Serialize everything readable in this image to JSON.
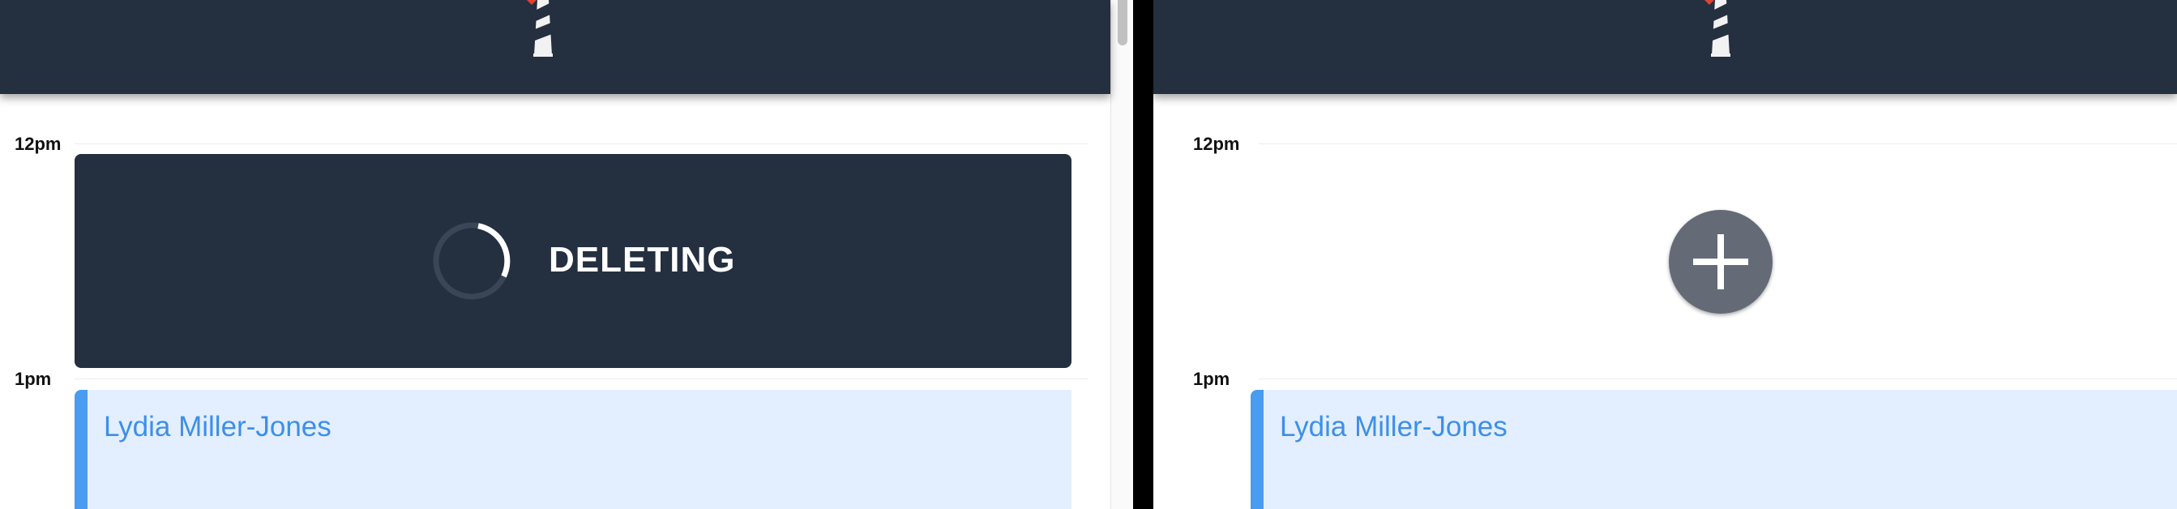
{
  "left_panel": {
    "time_labels": [
      "12pm",
      "1pm"
    ],
    "deleting_card": {
      "status_text": "DELETING",
      "spinner_icon": "loading-spinner-icon"
    },
    "appointment": {
      "client_name": "Lydia Miller-Jones"
    }
  },
  "right_panel": {
    "time_labels": [
      "12pm",
      "1pm"
    ],
    "add_button_icon": "plus-icon",
    "appointment": {
      "client_name": "Lydia Miller-Jones"
    }
  },
  "header": {
    "logo_icon": "lighthouse-logo-icon"
  },
  "colors": {
    "header_bg": "#242f40",
    "card_bg": "#242f40",
    "appointment_bg": "#e3efff",
    "appointment_accent": "#4a9bf2",
    "appointment_text": "#3d8fe8",
    "add_button_bg": "#646b76",
    "divider": "#000000"
  }
}
